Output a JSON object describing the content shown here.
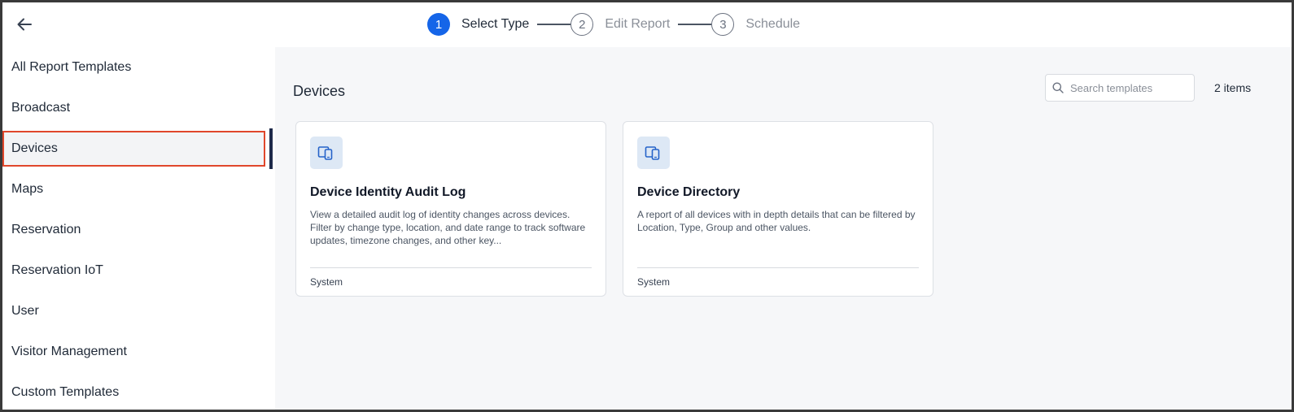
{
  "header": {
    "back_icon": "arrow-left-icon",
    "steps": [
      {
        "number": "1",
        "label": "Select Type",
        "state": "active"
      },
      {
        "number": "2",
        "label": "Edit Report",
        "state": "inactive"
      },
      {
        "number": "3",
        "label": "Schedule",
        "state": "inactive"
      }
    ]
  },
  "sidebar": {
    "items": [
      {
        "label": "All Report Templates"
      },
      {
        "label": "Broadcast"
      },
      {
        "label": "Devices"
      },
      {
        "label": "Maps"
      },
      {
        "label": "Reservation"
      },
      {
        "label": "Reservation IoT"
      },
      {
        "label": "User"
      },
      {
        "label": "Visitor Management"
      },
      {
        "label": "Custom Templates"
      }
    ],
    "selected": "Devices"
  },
  "main": {
    "title": "Devices",
    "search": {
      "placeholder": "Search templates",
      "value": ""
    },
    "count": "2 items",
    "cards": [
      {
        "icon": "devices-icon",
        "title": "Device Identity Audit Log",
        "description": "View a detailed audit log of identity changes across devices. Filter by change type, location, and date range to track software updates, timezone changes, and other key...",
        "footer": "System"
      },
      {
        "icon": "devices-icon",
        "title": "Device Directory",
        "description": "A report of all devices with in depth details that can be filtered by Location, Type, Group and other values.",
        "footer": "System"
      }
    ]
  },
  "colors": {
    "accent": "#1565e8",
    "selection_border": "#e0472b",
    "active_bar": "#1e2a4a",
    "main_bg": "#f6f7f9"
  }
}
